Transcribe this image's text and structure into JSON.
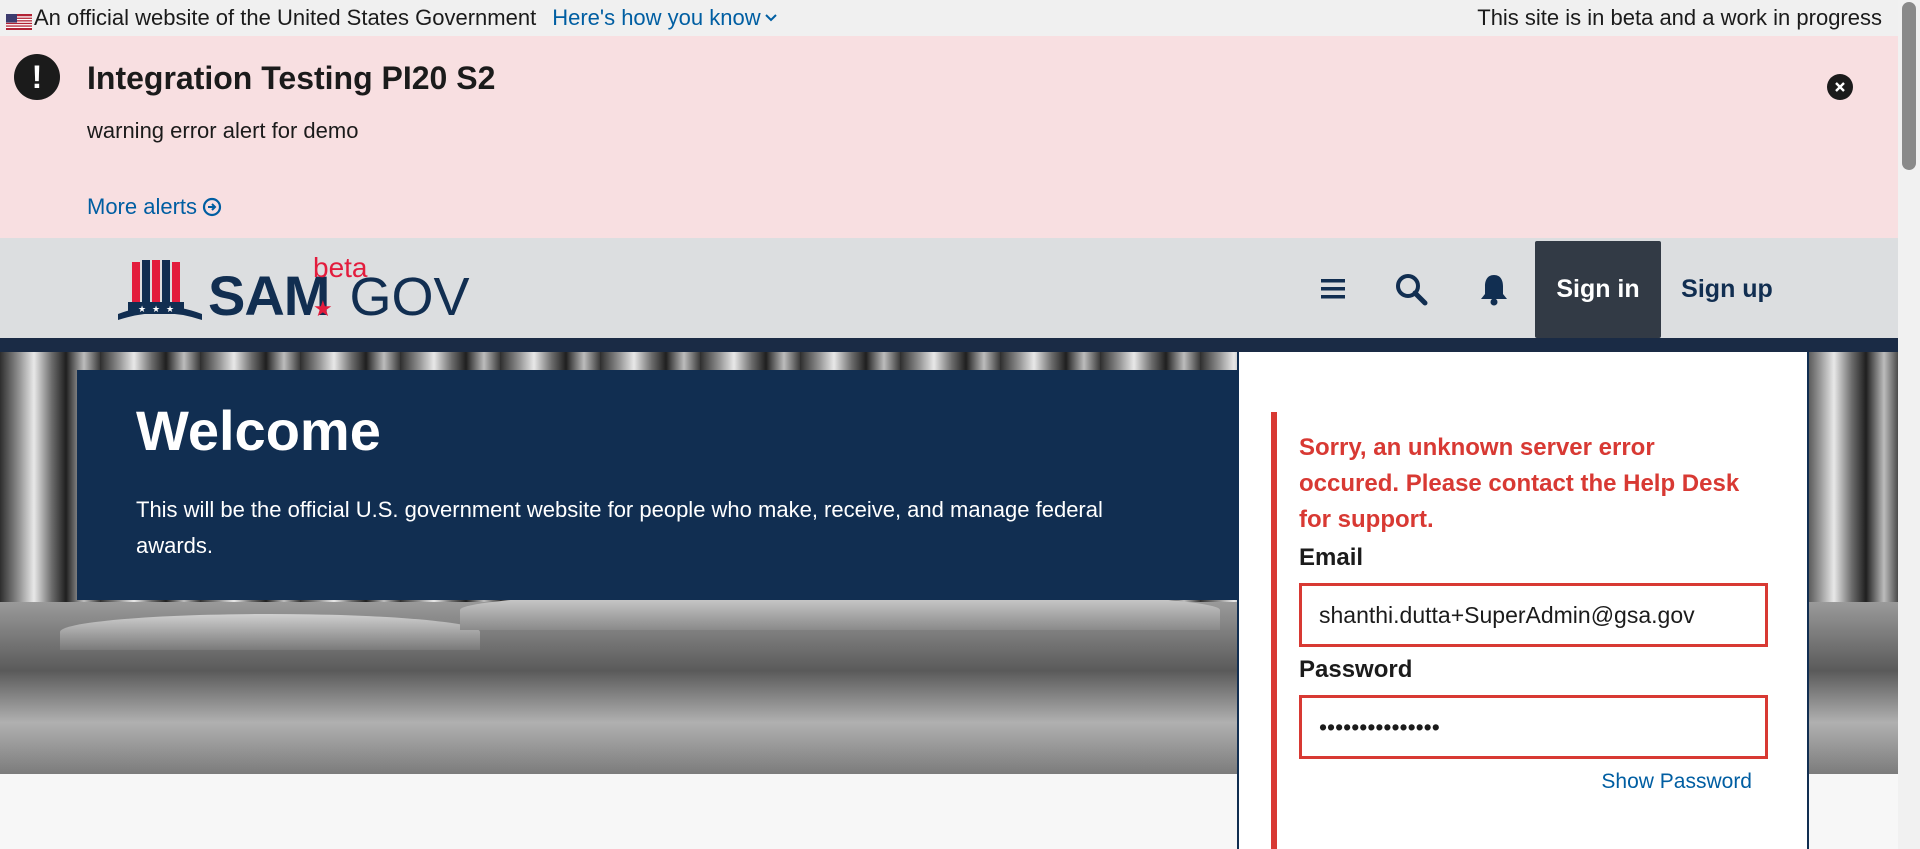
{
  "gov_banner": {
    "official_text": "An official website of the United States Government",
    "how_you_know": "Here's how you know",
    "beta_note": "This site is in beta and a work in progress"
  },
  "alert": {
    "title": "Integration Testing PI20 S2",
    "body": "warning error alert for demo",
    "more_link": "More alerts"
  },
  "header": {
    "logo": {
      "sam": "SAM",
      "beta": "beta",
      "gov": "GOV"
    },
    "icons": [
      "menu-icon",
      "search-icon",
      "bell-icon"
    ],
    "sign_in": "Sign in",
    "sign_up": "Sign up"
  },
  "hero": {
    "title": "Welcome",
    "text": "This will be the official U.S. government website for people who make, receive, and manage federal awards."
  },
  "login": {
    "error": "Sorry, an unknown server error occured. Please contact the Help Desk for support.",
    "email_label": "Email",
    "email_value": "shanthi.dutta+SuperAdmin@gsa.gov",
    "password_label": "Password",
    "password_value": "•••••••••••••••",
    "show_password": "Show Password"
  },
  "colors": {
    "alert_bg": "#f8dfe1",
    "header_bg": "#dcdee0",
    "navy": "#112e51",
    "error_red": "#d83933",
    "link_blue": "#005ea2"
  }
}
